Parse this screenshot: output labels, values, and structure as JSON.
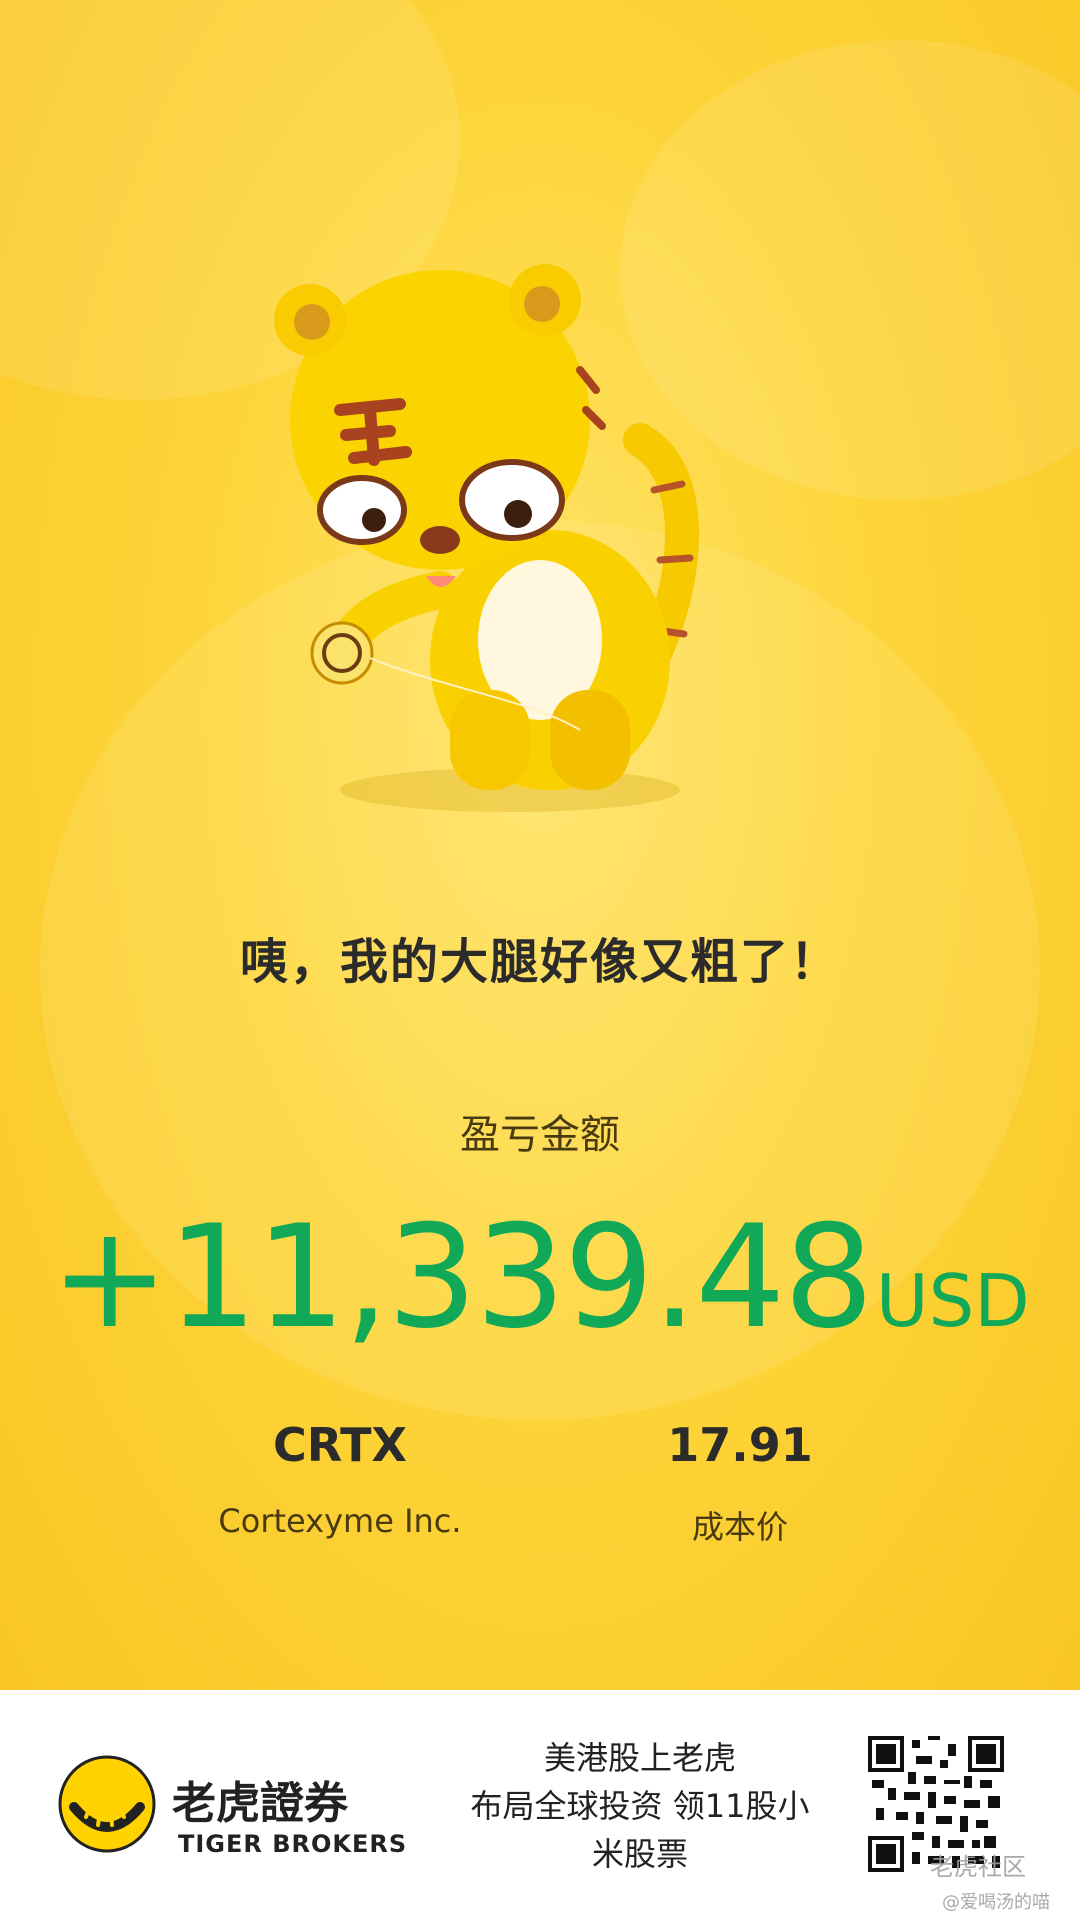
{
  "headline": "咦，我的大腿好像又粗了！",
  "profit": {
    "label": "盈亏金额",
    "amount": "+11,339.48",
    "currency": "USD",
    "color": "#11a857"
  },
  "stock": {
    "ticker": "CRTX",
    "company": "Cortexyme Inc."
  },
  "cost": {
    "value": "17.91",
    "label": "成本价"
  },
  "footer": {
    "brand_cn": "老虎證券",
    "brand_en": "TIGER BROKERS",
    "promo_lines": [
      "美港股上老虎",
      "布局全球投资 领11股小",
      "米股票"
    ],
    "qr_icon": "qr-code-icon"
  },
  "watermark": {
    "line1": "老虎社区",
    "line2": "@爱喝汤的喵"
  },
  "colors": {
    "background": "#fdd53a",
    "accent_green": "#11a857"
  }
}
